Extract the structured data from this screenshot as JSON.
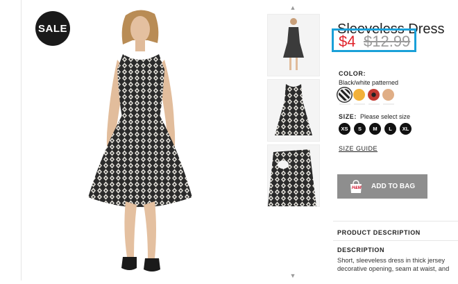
{
  "badge": {
    "label": "SALE"
  },
  "product": {
    "title": "Sleeveless Dress",
    "price_sale": "$4",
    "price_original": "$12.99"
  },
  "color": {
    "label": "COLOR:",
    "selected_name": "Black/white patterned",
    "swatches": [
      {
        "name": "black-white-patterned",
        "hex": "#444444"
      },
      {
        "name": "yellow",
        "hex": "#f2b13a"
      },
      {
        "name": "red-patterned",
        "hex": "#c23a32"
      },
      {
        "name": "beige",
        "hex": "#e0ae86"
      }
    ]
  },
  "size": {
    "label": "SIZE:",
    "hint": "Please select size",
    "options": [
      "XS",
      "S",
      "M",
      "L",
      "XL"
    ],
    "guide_label": "SIZE GUIDE"
  },
  "cart": {
    "add_label": "ADD TO BAG",
    "brand": "H&M"
  },
  "description": {
    "section_title": "PRODUCT DESCRIPTION",
    "heading": "DESCRIPTION",
    "text_line1": "Short, sleeveless dress in thick jersey",
    "text_line2": "decorative opening, seam at waist, and"
  },
  "gallery": {
    "up_arrow": "▲",
    "down_arrow": "▼"
  }
}
